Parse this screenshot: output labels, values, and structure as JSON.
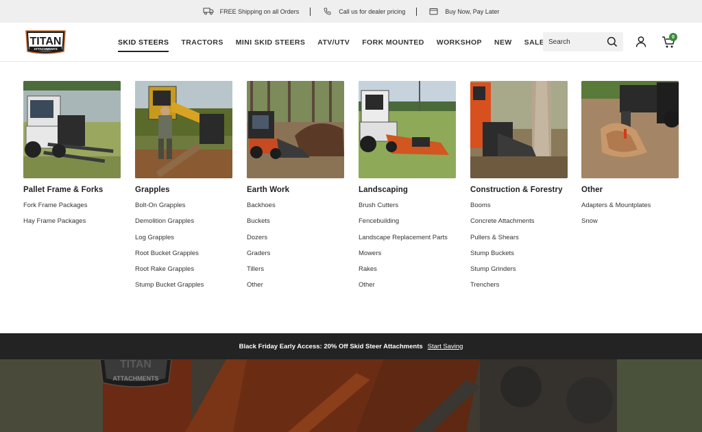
{
  "topbar": {
    "shipping": "FREE Shipping on all Orders",
    "dealer": "Call us for dealer pricing",
    "financing": "Buy Now, Pay Later",
    "icons": [
      "truck-icon",
      "phone-icon",
      "wallet-icon"
    ]
  },
  "header": {
    "logo_top": "TITAN",
    "logo_bottom": "ATTACHMENTS",
    "nav": [
      "SKID STEERS",
      "TRACTORS",
      "MINI SKID STEERS",
      "ATV/UTV",
      "FORK MOUNTED",
      "WORKSHOP",
      "NEW",
      "SALE"
    ],
    "active_nav": "SKID STEERS",
    "search_placeholder": "Search",
    "cart_count": "0",
    "badge_color": "#3a8a3a"
  },
  "menu": {
    "columns": [
      {
        "title": "Pallet Frame & Forks",
        "links": [
          "Fork Frame Packages",
          "Hay Frame Packages"
        ]
      },
      {
        "title": "Grapples",
        "links": [
          "Bolt-On Grapples",
          "Demolition Grapples",
          "Log Grapples",
          "Root Bucket Grapples",
          "Root Rake Grapples",
          "Stump Bucket Grapples"
        ]
      },
      {
        "title": "Earth Work",
        "links": [
          "Backhoes",
          "Buckets",
          "Dozers",
          "Graders",
          "Tillers",
          "Other"
        ]
      },
      {
        "title": "Landscaping",
        "links": [
          "Brush Cutters",
          "Fencebuilding",
          "Landscape Replacement Parts",
          "Mowers",
          "Rakes",
          "Other"
        ]
      },
      {
        "title": "Construction & Forestry",
        "links": [
          "Booms",
          "Concrete Attachments",
          "Pullers & Shears",
          "Stump Buckets",
          "Stump Grinders",
          "Trenchers"
        ]
      },
      {
        "title": "Other",
        "links": [
          "Adapters & Mountplates",
          "Snow"
        ]
      }
    ]
  },
  "promo": {
    "text": "Black Friday Early Access: 20% Off Skid Steer Attachments",
    "link": "Start Saving"
  },
  "hero": {
    "logo_top": "TITAN",
    "logo_bottom": "ATTACHMENTS"
  }
}
